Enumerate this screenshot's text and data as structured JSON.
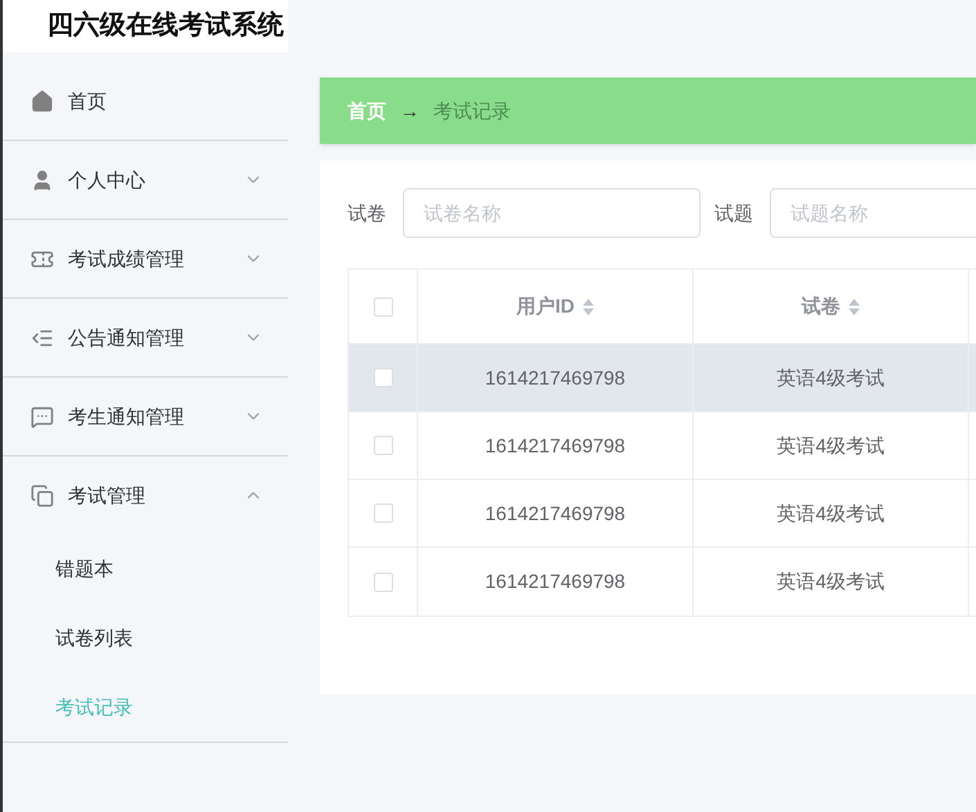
{
  "app_title": "四六级在线考试系统",
  "menu": [
    {
      "label": "首页",
      "kind": "home"
    },
    {
      "label": "个人中心",
      "kind": "user",
      "expanded": false
    },
    {
      "label": "考试成绩管理",
      "kind": "ticket",
      "expanded": false
    },
    {
      "label": "公告通知管理",
      "kind": "list",
      "expanded": false
    },
    {
      "label": "考生通知管理",
      "kind": "chat",
      "expanded": false
    },
    {
      "label": "考试管理",
      "kind": "copy",
      "expanded": true,
      "children": [
        {
          "label": "错题本",
          "selected": false
        },
        {
          "label": "试卷列表",
          "selected": false
        },
        {
          "label": "考试记录",
          "selected": true
        }
      ]
    }
  ],
  "breadcrumb": {
    "home": "首页",
    "separator": "→",
    "current": "考试记录"
  },
  "filters": [
    {
      "label": "试卷",
      "placeholder": "试卷名称"
    },
    {
      "label": "试题",
      "placeholder": "试题名称"
    }
  ],
  "table": {
    "header_checked": false,
    "columns": [
      "用户ID",
      "试卷"
    ],
    "rows": [
      {
        "checked": false,
        "highlighted": true,
        "cells": [
          "1614217469798",
          "英语4级考试"
        ]
      },
      {
        "checked": false,
        "highlighted": false,
        "cells": [
          "1614217469798",
          "英语4级考试"
        ]
      },
      {
        "checked": false,
        "highlighted": false,
        "cells": [
          "1614217469798",
          "英语4级考试"
        ]
      },
      {
        "checked": false,
        "highlighted": false,
        "cells": [
          "1614217469798",
          "英语4级考试"
        ]
      }
    ]
  }
}
